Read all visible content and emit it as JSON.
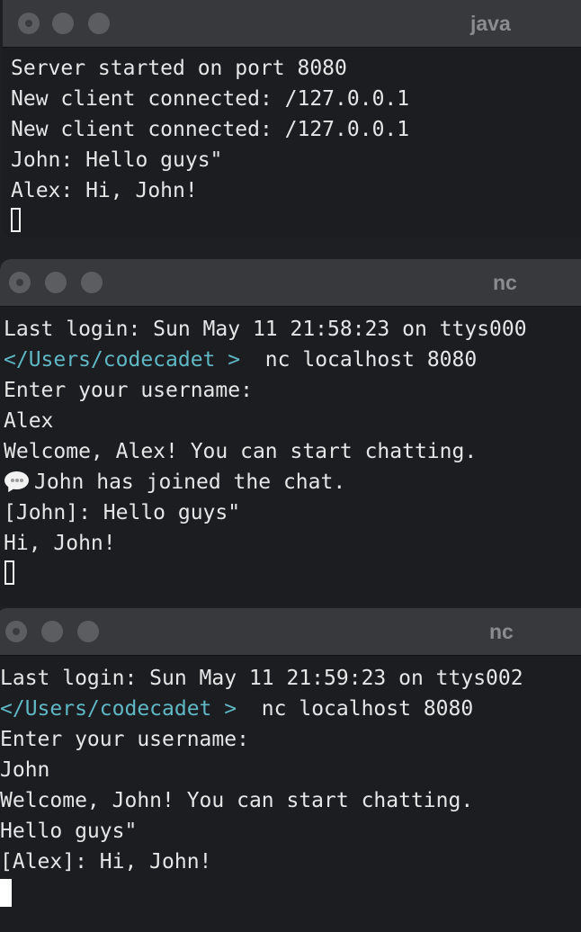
{
  "windows": [
    {
      "title": "java",
      "lines": [
        {
          "text": "Server started on port 8080"
        },
        {
          "text": "New client connected: /127.0.0.1"
        },
        {
          "text": "New client connected: /127.0.0.1"
        },
        {
          "text": "John: Hello guys\""
        },
        {
          "text": "Alex: Hi, John!"
        }
      ]
    },
    {
      "title": "nc",
      "lines": [
        {
          "text": "Last login: Sun May 11 21:58:23 on ttys000"
        },
        {
          "prompt": "</Users/codecadet >",
          "text": "  nc localhost 8080"
        },
        {
          "text": "Enter your username:"
        },
        {
          "text": "Alex"
        },
        {
          "text": "Welcome, Alex! You can start chatting."
        },
        {
          "icon": "speech-bubble-icon",
          "text": "John has joined the chat."
        },
        {
          "text": "[John]: Hello guys\""
        },
        {
          "text": "Hi, John!"
        }
      ]
    },
    {
      "title": "nc",
      "lines": [
        {
          "text": "Last login: Sun May 11 21:59:23 on ttys002"
        },
        {
          "prompt": "</Users/codecadet >",
          "text": "  nc localhost 8080"
        },
        {
          "text": "Enter your username:"
        },
        {
          "text": "John"
        },
        {
          "text": "Welcome, John! You can start chatting."
        },
        {
          "text": "Hello guys\""
        },
        {
          "text": "[Alex]: Hi, John!"
        }
      ]
    }
  ],
  "colors": {
    "terminal_bg": "#1b1d21",
    "titlebar_bg": "#38393c",
    "text": "#e6e6e6",
    "prompt": "#5fb8c4",
    "title_text": "#8b8c8f"
  }
}
